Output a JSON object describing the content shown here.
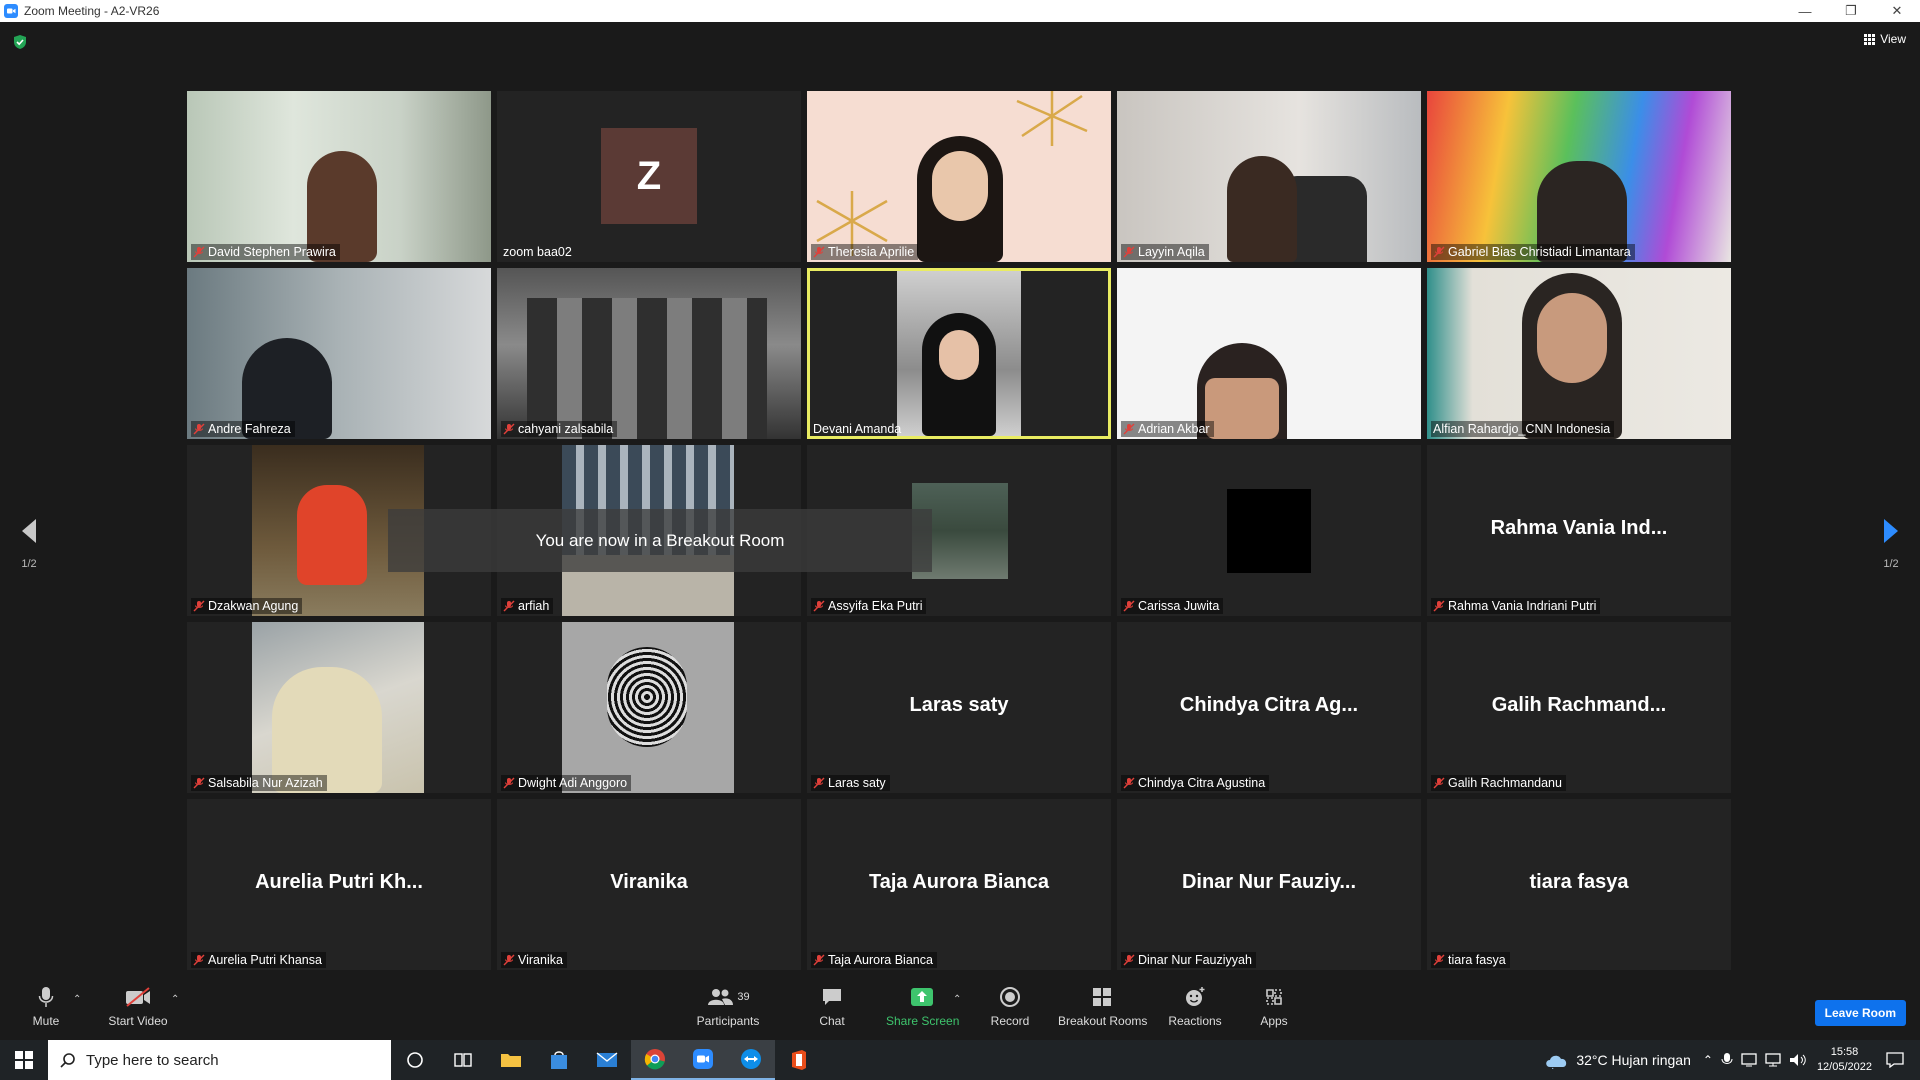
{
  "window": {
    "title": "Zoom Meeting - A2-VR26"
  },
  "meeting": {
    "view_label": "View",
    "page_left": "1/2",
    "page_right": "1/2",
    "toast": "You are now in a Breakout Room"
  },
  "participants": [
    {
      "name": "David Stephen Prawira",
      "muted": true,
      "video": true
    },
    {
      "name": "zoom baa02",
      "muted": false,
      "video": false,
      "avatar_letter": "Z"
    },
    {
      "name": "Theresia Aprilie",
      "muted": true,
      "video": true
    },
    {
      "name": "Layyin Aqila",
      "muted": true,
      "video": true
    },
    {
      "name": "Gabriel Bias Christiadi Limantara",
      "muted": true,
      "video": true
    },
    {
      "name": "Andre Fahreza",
      "muted": true,
      "video": true
    },
    {
      "name": "cahyani zalsabila",
      "muted": true,
      "video": true
    },
    {
      "name": "Devani Amanda",
      "muted": false,
      "video": true,
      "active_speaker": true
    },
    {
      "name": "Adrian Akbar",
      "muted": true,
      "video": true
    },
    {
      "name": "Alfian Rahardjo_CNN Indonesia",
      "muted": false,
      "video": true
    },
    {
      "name": "Dzakwan Agung",
      "muted": true,
      "video": true
    },
    {
      "name": "arfiah",
      "muted": true,
      "video": true
    },
    {
      "name": "Assyifa Eka Putri",
      "muted": true,
      "video": true
    },
    {
      "name": "Carissa Juwita",
      "muted": true,
      "video": true
    },
    {
      "name": "Rahma Vania Indriani Putri",
      "muted": true,
      "video": false,
      "display": "Rahma Vania Ind..."
    },
    {
      "name": "Salsabila Nur Azizah",
      "muted": true,
      "video": true
    },
    {
      "name": "Dwight Adi Anggoro",
      "muted": true,
      "video": true
    },
    {
      "name": "Laras saty",
      "muted": true,
      "video": false,
      "display": "Laras saty"
    },
    {
      "name": "Chindya Citra Agustina",
      "muted": true,
      "video": false,
      "display": "Chindya Citra Ag..."
    },
    {
      "name": "Galih Rachmandanu",
      "muted": true,
      "video": false,
      "display": "Galih  Rachmand..."
    },
    {
      "name": "Aurelia Putri Khansa",
      "muted": true,
      "video": false,
      "display": "Aurelia Putri Kh..."
    },
    {
      "name": "Viranika",
      "muted": true,
      "video": false,
      "display": "Viranika"
    },
    {
      "name": "Taja Aurora Bianca",
      "muted": true,
      "video": false,
      "display": "Taja Aurora Bianca"
    },
    {
      "name": "Dinar Nur Fauziyyah",
      "muted": true,
      "video": false,
      "display": "Dinar Nur Fauziy..."
    },
    {
      "name": "tiara fasya",
      "muted": true,
      "video": false,
      "display": "tiara fasya"
    }
  ],
  "toolbar": {
    "mute": "Mute",
    "start_video": "Start Video",
    "participants": "Participants",
    "participants_count": "39",
    "chat": "Chat",
    "share_screen": "Share Screen",
    "record": "Record",
    "breakout_rooms": "Breakout Rooms",
    "reactions": "Reactions",
    "apps": "Apps",
    "leave": "Leave Room"
  },
  "taskbar": {
    "search_placeholder": "Type here to search",
    "weather": "32°C  Hujan ringan",
    "time": "15:58",
    "date": "12/05/2022"
  },
  "colors": {
    "accent_blue": "#0e72ed",
    "active_speaker": "#e9ec62",
    "share_green": "#3ec46d",
    "mic_off_red": "#e0403a"
  }
}
